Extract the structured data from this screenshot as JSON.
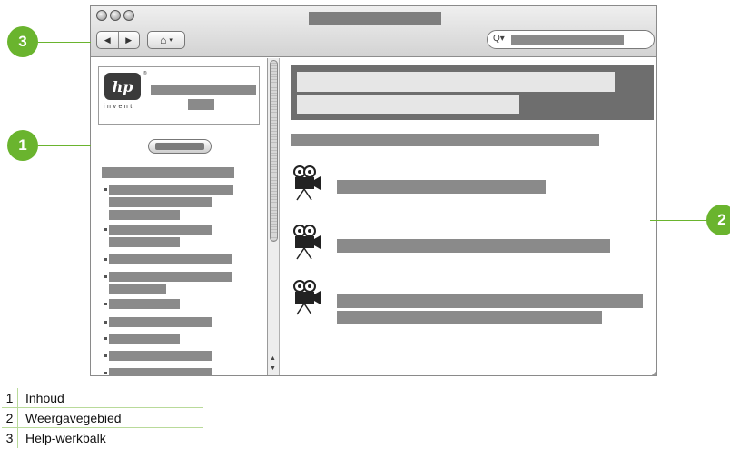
{
  "window": {
    "toolbar": {
      "back_glyph": "◀",
      "forward_glyph": "▶",
      "home_glyph": "⌂",
      "home_caret": "▾",
      "search_glyph": "Q▾"
    },
    "logo": {
      "brand": "hp",
      "tagline": "invent",
      "mark": "®"
    }
  },
  "callouts": [
    "1",
    "2",
    "3"
  ],
  "legend": [
    {
      "num": "1",
      "label": "Inhoud"
    },
    {
      "num": "2",
      "label": "Weergavegebied"
    },
    {
      "num": "3",
      "label": "Help-werkbalk"
    }
  ],
  "icons": {
    "toolbar": [
      "back-arrow-icon",
      "forward-arrow-icon",
      "home-icon",
      "search-icon"
    ],
    "main": [
      "video-camera-icon"
    ]
  },
  "colors": {
    "callout": "#6ab42e",
    "placeholder": "#8a8a8a",
    "banner": "#6e6e6e"
  }
}
